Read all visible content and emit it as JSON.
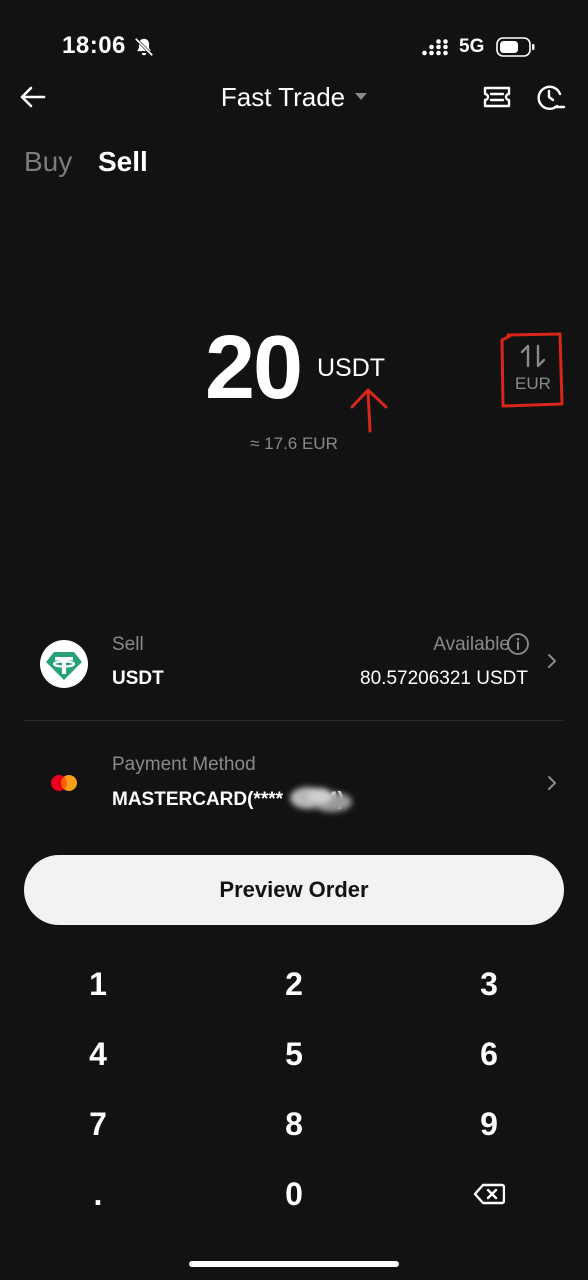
{
  "status_bar": {
    "time": "18:06",
    "network": "5G",
    "icons": [
      "bell-off-icon",
      "signal-icon",
      "battery-icon"
    ]
  },
  "header": {
    "title": "Fast Trade",
    "icons": [
      "back-arrow-icon",
      "caret-down-icon",
      "ticket-icon",
      "history-icon"
    ]
  },
  "tabs": [
    {
      "label": "Buy",
      "active": false
    },
    {
      "label": "Sell",
      "active": true
    }
  ],
  "amount": {
    "value": "20",
    "currency": "USDT",
    "approx": "≈ 17.6 EUR",
    "switch_label": "EUR",
    "switch_icon": "swap-vertical-icon"
  },
  "sell_row": {
    "label": "Sell",
    "asset": "USDT",
    "available_label": "Available",
    "available_value": "80.57206321 USDT",
    "icon": "tether-icon"
  },
  "payment_row": {
    "label": "Payment Method",
    "value": "MASTERCARD(****",
    "value_suffix": "4)",
    "icon": "mastercard-icon"
  },
  "preview_button": "Preview Order",
  "keypad": {
    "keys": [
      "1",
      "2",
      "3",
      "4",
      "5",
      "6",
      "7",
      "8",
      "9",
      ".",
      "0"
    ],
    "backspace_icon": "backspace-icon"
  },
  "colors": {
    "background": "#121212",
    "text_primary": "#ffffff",
    "text_muted": "#8a8a8a",
    "tether_green": "#26a17b",
    "mastercard_red": "#eb001b",
    "mastercard_orange": "#f79e1b",
    "annotation_red": "#d8261b",
    "button_bg": "#f2f2f2"
  }
}
